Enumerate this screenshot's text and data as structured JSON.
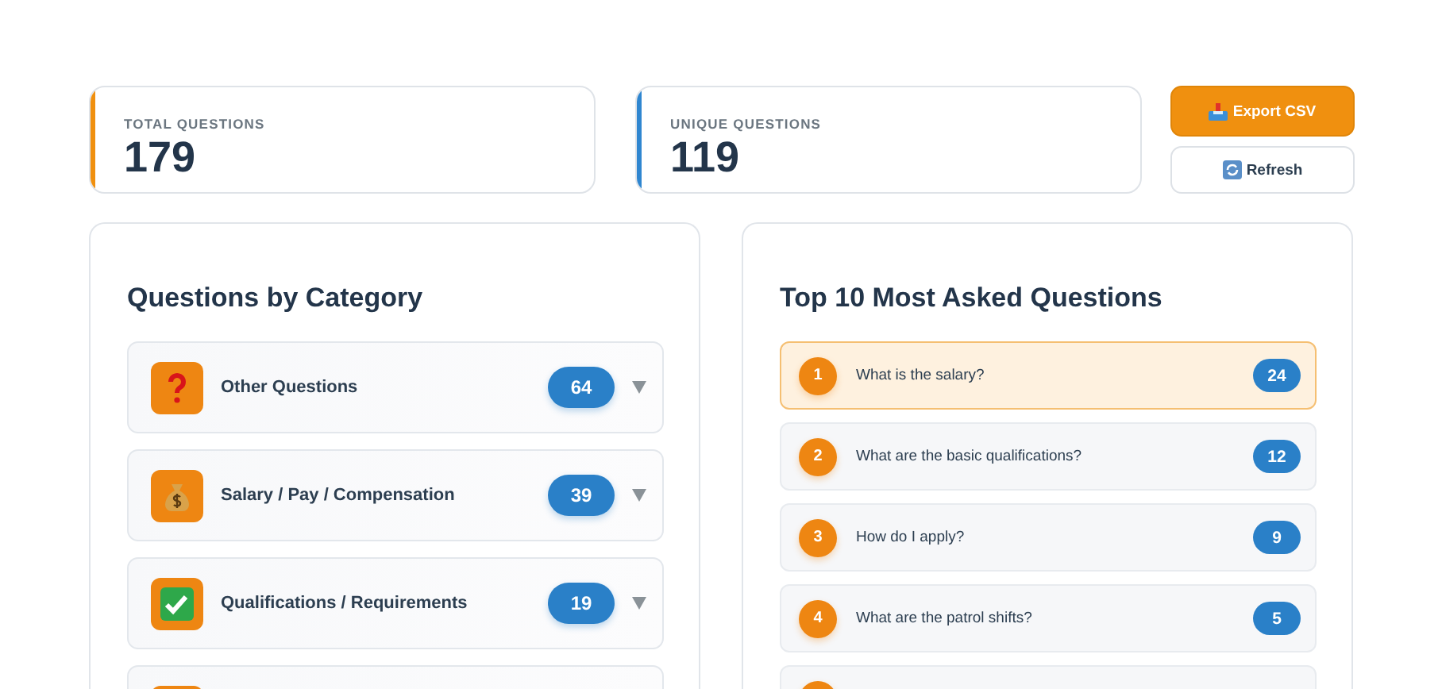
{
  "stats": [
    {
      "label": "TOTAL QUESTIONS",
      "value": "179",
      "color": "#f0900f"
    },
    {
      "label": "UNIQUE QUESTIONS",
      "value": "119",
      "color": "#2f86d0"
    }
  ],
  "actions": [
    {
      "kind": "export",
      "label": "Export CSV",
      "primary": true
    },
    {
      "kind": "refresh",
      "label": "Refresh",
      "primary": false
    }
  ],
  "categories_panel": {
    "title": "Questions by Category",
    "items": [
      {
        "kind": "question",
        "label": "Other Questions",
        "count": "64",
        "expanded": false
      },
      {
        "kind": "money",
        "label": "Salary / Pay / Compensation",
        "count": "39",
        "expanded": false
      },
      {
        "kind": "check",
        "label": "Qualifications / Requirements",
        "count": "19",
        "expanded": false
      },
      {
        "kind": "hidden"
      }
    ]
  },
  "top_panel": {
    "title": "Top 10 Most Asked Questions",
    "items": [
      {
        "rank": "1",
        "question": "What is the salary?",
        "count": "24",
        "highlighted": true
      },
      {
        "rank": "2",
        "question": "What are the basic qualifications?",
        "count": "12",
        "highlighted": false
      },
      {
        "rank": "3",
        "question": "How do I apply?",
        "count": "9",
        "highlighted": false
      },
      {
        "rank": "4",
        "question": "What are the patrol shifts?",
        "count": "5",
        "highlighted": false
      },
      {
        "highlighted": false
      }
    ]
  }
}
